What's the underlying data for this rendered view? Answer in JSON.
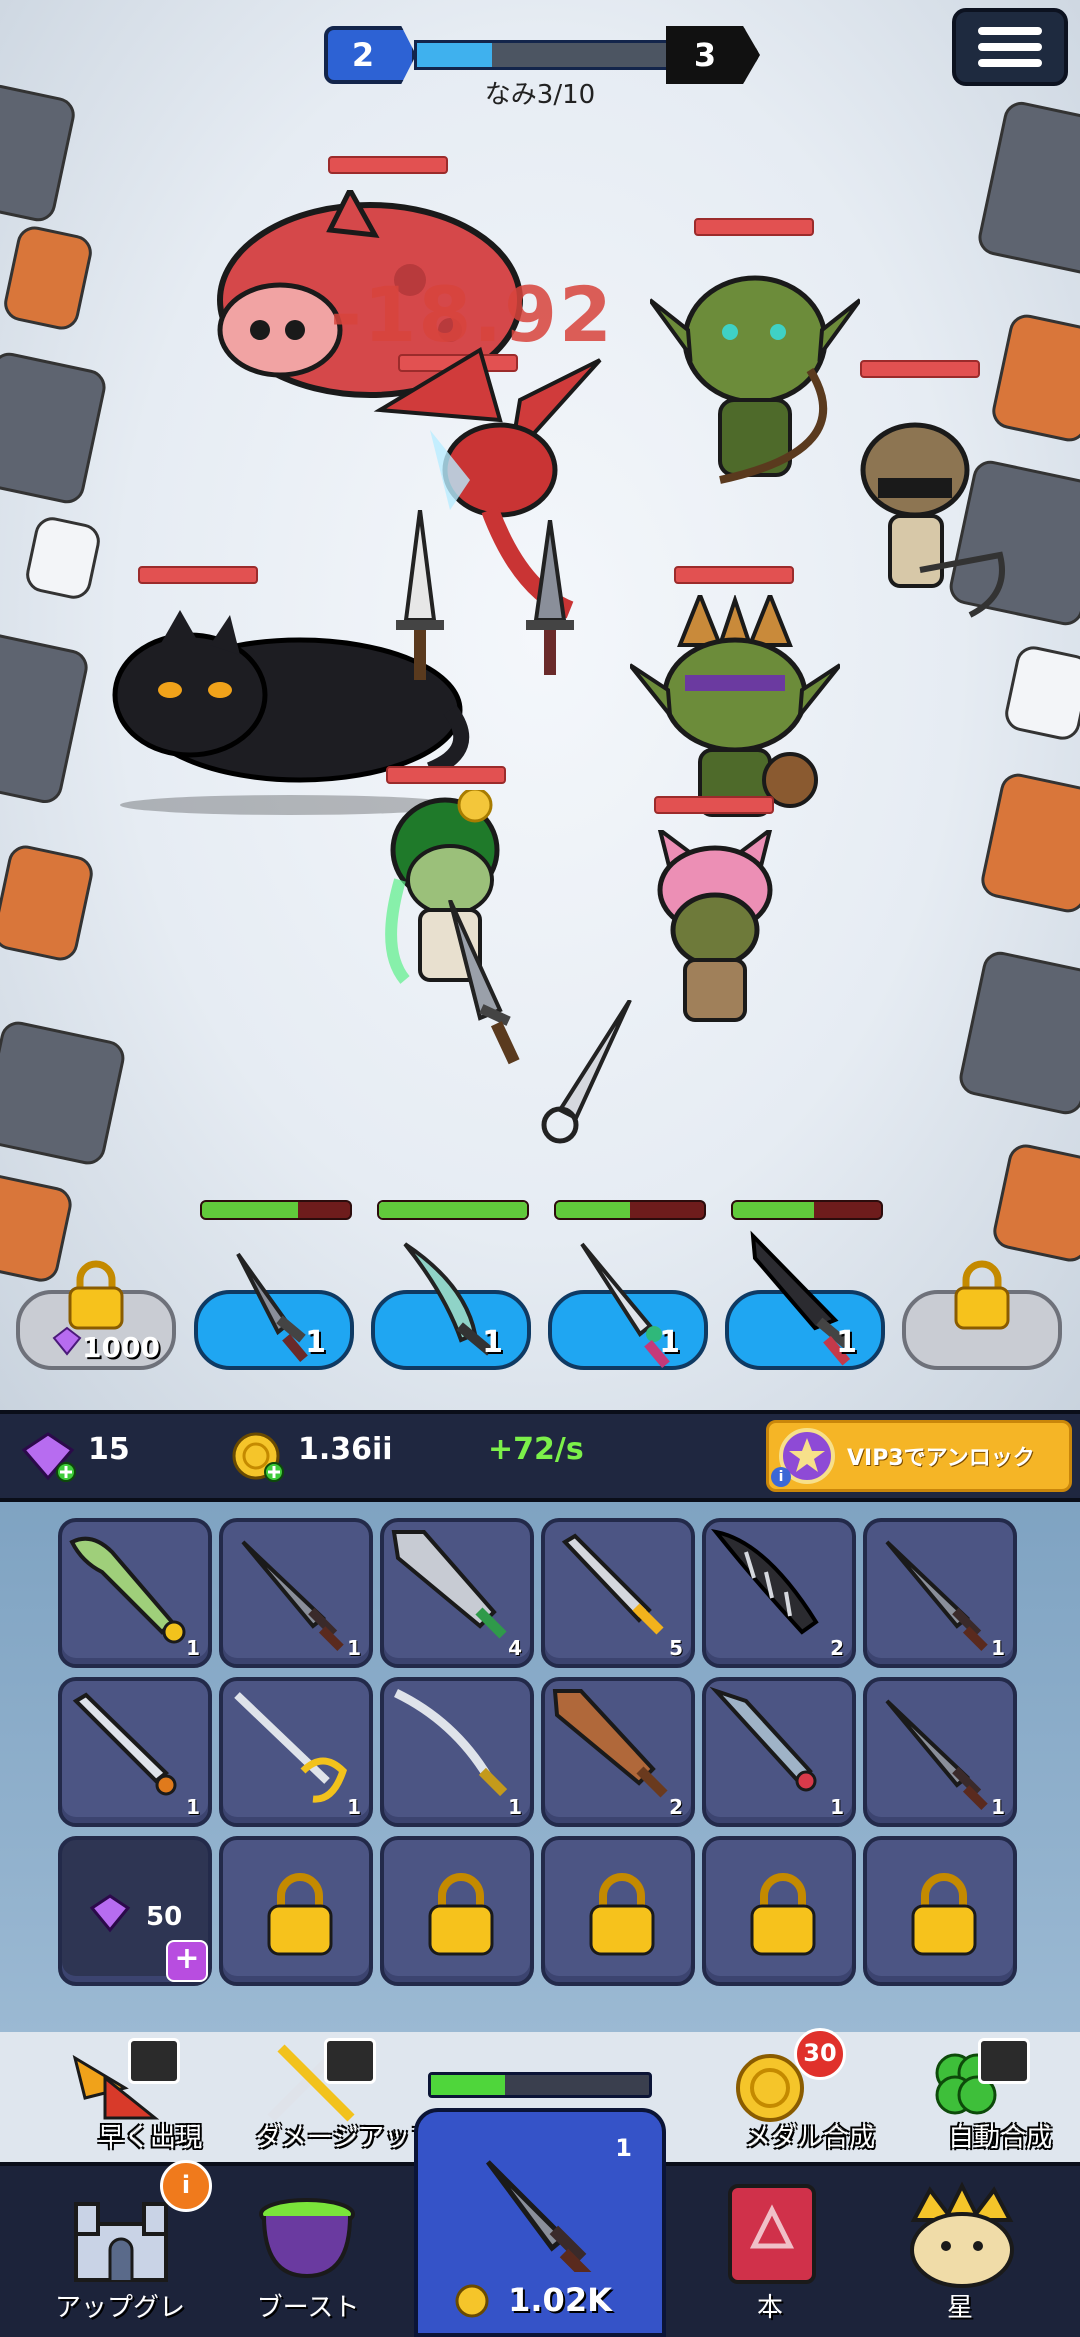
{
  "stage": {
    "current": "2",
    "next": "3",
    "wave_label": "なみ3/10",
    "progress": 0.3
  },
  "combat": {
    "damage_number": "-18.92"
  },
  "hero_slots": [
    {
      "state": "locked",
      "cost": "1000",
      "icon": "gem-icon"
    },
    {
      "state": "filled",
      "level": "1",
      "hp": 0.65,
      "weapon": "dagger"
    },
    {
      "state": "filled",
      "level": "1",
      "hp": 1.0,
      "weapon": "curved-sword"
    },
    {
      "state": "filled",
      "level": "1",
      "hp": 0.5,
      "weapon": "jeweled-sword"
    },
    {
      "state": "filled",
      "level": "1",
      "hp": 0.55,
      "weapon": "dark-blade"
    },
    {
      "state": "locked",
      "icon": "lock-icon"
    }
  ],
  "resources": {
    "gems": "15",
    "gold": "1.36ii",
    "gold_rate": "+72/s",
    "vip_text": "VIP3でアンロック"
  },
  "inventory": {
    "row1": [
      {
        "weapon": "green-bone-sword",
        "level": "1"
      },
      {
        "weapon": "dagger",
        "level": "1"
      },
      {
        "weapon": "broad-sword-green-hilt",
        "level": "4"
      },
      {
        "weapon": "gold-hilt-sword",
        "level": "5"
      },
      {
        "weapon": "spiked-cleaver",
        "level": "2"
      },
      {
        "weapon": "dagger",
        "level": "1"
      }
    ],
    "row2": [
      {
        "weapon": "orange-hilt-sword",
        "level": "1"
      },
      {
        "weapon": "golden-rapier",
        "level": "1"
      },
      {
        "weapon": "katana",
        "level": "1"
      },
      {
        "weapon": "wooden-sword",
        "level": "2"
      },
      {
        "weapon": "crystal-sword",
        "level": "1"
      },
      {
        "weapon": "dagger",
        "level": "1"
      }
    ],
    "buy_slot_cost": "50",
    "locked_slots": 5
  },
  "actions": [
    {
      "label": "早く出現",
      "icon": "winged-boot-icon"
    },
    {
      "label": "ダメージアップ",
      "icon": "crossed-swords-icon"
    },
    {
      "label": "メダル合成",
      "icon": "medal-icon",
      "badge": "30"
    },
    {
      "label": "自動合成",
      "icon": "clover-icon"
    }
  ],
  "summon": {
    "count": "1",
    "price": "1.02K",
    "progress": 0.34
  },
  "nav": [
    {
      "label": "アップグレ",
      "icon": "castle-icon"
    },
    {
      "label": "ブースト",
      "icon": "cauldron-icon"
    },
    {
      "label": "本",
      "icon": "book-icon"
    },
    {
      "label": "星",
      "icon": "crown-lion-icon"
    }
  ],
  "colors": {
    "accent_blue": "#2d62d4",
    "gold": "#f5b526",
    "hp_red": "#e25151",
    "hp_green": "#61c93b",
    "nav_bg": "#1c233a"
  }
}
